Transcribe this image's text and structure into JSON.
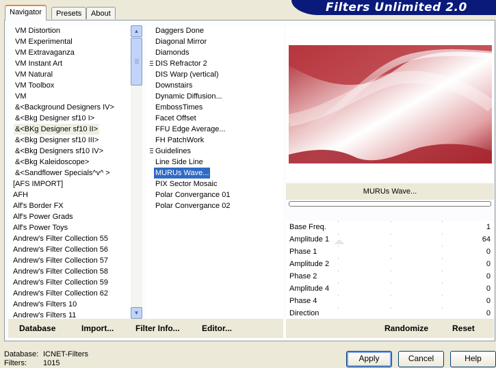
{
  "banner": {
    "title": "Filters Unlimited 2.0"
  },
  "tabs": [
    {
      "label": "Navigator",
      "active": true
    },
    {
      "label": "Presets",
      "active": false
    },
    {
      "label": "About",
      "active": false
    }
  ],
  "categories": [
    "VM Distortion",
    "VM Experimental",
    "VM Extravaganza",
    "VM Instant Art",
    "VM Natural",
    "VM Toolbox",
    "VM",
    "&<Background Designers IV>",
    "&<Bkg Designer sf10 I>",
    "&<BKg Designer sf10 II>",
    "&<Bkg Designer sf10 III>",
    "&<Bkg Designers sf10 IV>",
    "&<Bkg Kaleidoscope>",
    "&<Sandflower Specials^v^ >",
    "[AFS IMPORT]",
    "AFH",
    "Alf's Border FX",
    "Alf's Power Grads",
    "Alf's Power Toys",
    "Andrew's Filter Collection 55",
    "Andrew's Filter Collection 56",
    "Andrew's Filter Collection 57",
    "Andrew's Filter Collection 58",
    "Andrew's Filter Collection 59",
    "Andrew's Filter Collection 62",
    "Andrew's Filters 10",
    "Andrew's Filters 11"
  ],
  "filters": [
    "Daggers Done",
    "Diagonal Mirror",
    "Diamonds",
    "DIS Refractor 2",
    "DIS Warp (vertical)",
    "Downstairs",
    "Dynamic Diffusion...",
    "EmbossTimes",
    "Facet Offset",
    "FFU Edge Average...",
    "FH PatchWork",
    "Guidelines",
    "Line Side Line",
    "MURUs Wave...",
    "PIX Sector Mosaic",
    "Polar Convergance 01",
    "Polar Convergance 02"
  ],
  "preview": {
    "filter_name": "MURUs Wave...",
    "colors": {
      "dark": "#a8242e",
      "light": "#ffffff"
    }
  },
  "params": [
    {
      "name": "Base Freq.",
      "value": "1"
    },
    {
      "name": "Amplitude 1",
      "value": "64"
    },
    {
      "name": "Phase 1",
      "value": "0"
    },
    {
      "name": "Amplitude 2",
      "value": "0"
    },
    {
      "name": "Phase 2",
      "value": "0"
    },
    {
      "name": "Amplitude 4",
      "value": "0"
    },
    {
      "name": "Phase 4",
      "value": "0"
    },
    {
      "name": "Direction",
      "value": "0"
    }
  ],
  "actions": {
    "database": "Database",
    "import": "Import...",
    "filter_info": "Filter Info...",
    "editor": "Editor...",
    "randomize": "Randomize",
    "reset": "Reset"
  },
  "footer": {
    "database_label": "Database:",
    "database_value": "ICNET-Filters",
    "filters_label": "Filters:",
    "filters_value": "1015"
  },
  "dialog": {
    "apply": "Apply",
    "cancel": "Cancel",
    "help": "Help"
  }
}
